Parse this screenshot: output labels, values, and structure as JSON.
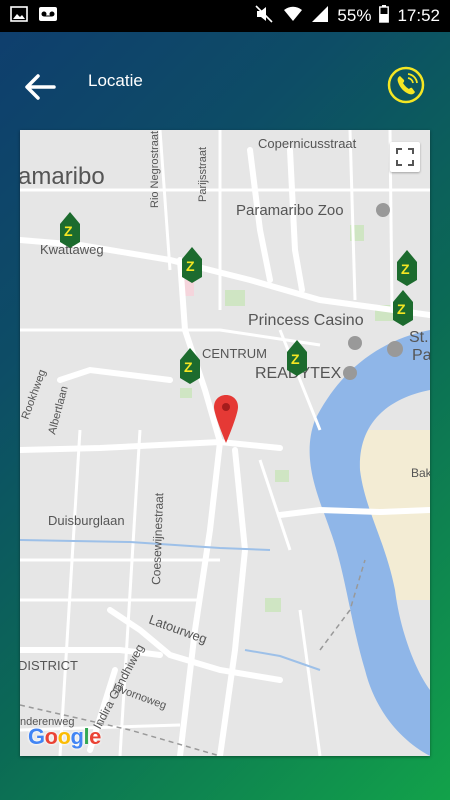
{
  "status_bar": {
    "battery": "55%",
    "time": "17:52"
  },
  "app_bar": {
    "title": "Locatie"
  },
  "map": {
    "labels": {
      "city": "amaribo",
      "copernicus": "Copernicusstraat",
      "rio_negro": "Rio Negrostraat",
      "parijs": "Parijsstraat",
      "zoo": "Paramaribo Zoo",
      "kwatta": "Kwattaweg",
      "casino": "Princess Casino",
      "st_p": "St.",
      "st_p2": "Pa",
      "centrum": "CENTRUM",
      "readytex": "READYTEX",
      "rookhweg": "Rookhweg",
      "albertlaan": "Albertlaan",
      "coesewijne": "Coesewijnestraat",
      "duisburg": "Duisburglaan",
      "bak": "Bak",
      "latour": "Latourweg",
      "district": "DISTRICT",
      "indira": "Indira Gandhiweg",
      "livorno": "Livornoweg",
      "nderen": "nderenweg"
    },
    "google_logo": "Google"
  },
  "colors": {
    "accent_yellow": "#f5e623",
    "pin_red": "#e53935",
    "water_blue": "#8fb6e8",
    "marker_green": "#1c6b2e"
  }
}
